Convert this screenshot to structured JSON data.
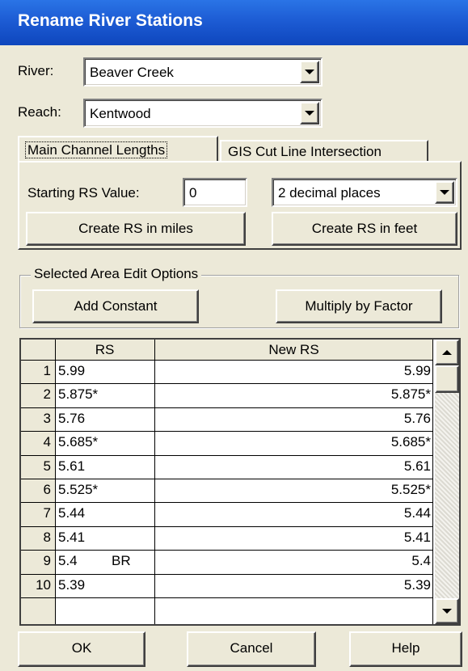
{
  "window": {
    "title": "Rename River Stations"
  },
  "river": {
    "label": "River:",
    "value": "Beaver Creek"
  },
  "reach": {
    "label": "Reach:",
    "value": "Kentwood"
  },
  "tabs": [
    {
      "label": "Main Channel Lengths",
      "active": true
    },
    {
      "label": "GIS Cut Line Intersection",
      "active": false
    }
  ],
  "main_channel": {
    "starting_rs_label": "Starting RS  Value:",
    "starting_rs_value": "0",
    "decimal_places": "2 decimal places",
    "create_miles_label": "Create RS in miles",
    "create_feet_label": "Create RS in feet"
  },
  "edit_options": {
    "group_title": "Selected Area Edit Options",
    "add_constant_label": "Add Constant",
    "multiply_factor_label": "Multiply by  Factor"
  },
  "table": {
    "columns": [
      "",
      "RS",
      "New RS"
    ],
    "rows": [
      {
        "num": "1",
        "rs": "5.99",
        "new_rs": "5.99"
      },
      {
        "num": "2",
        "rs": "5.875*",
        "new_rs": "5.875*"
      },
      {
        "num": "3",
        "rs": "5.76",
        "new_rs": "5.76"
      },
      {
        "num": "4",
        "rs": "5.685*",
        "new_rs": "5.685*"
      },
      {
        "num": "5",
        "rs": "5.61",
        "new_rs": "5.61"
      },
      {
        "num": "6",
        "rs": "5.525*",
        "new_rs": "5.525*"
      },
      {
        "num": "7",
        "rs": "5.44",
        "new_rs": "5.44"
      },
      {
        "num": "8",
        "rs": "5.41",
        "new_rs": "5.41"
      },
      {
        "num": "9",
        "rs": "5.4",
        "rs_tag": "BR",
        "new_rs": "5.4"
      },
      {
        "num": "10",
        "rs": "5.39",
        "new_rs": "5.39"
      }
    ]
  },
  "footer": {
    "ok_label": "OK",
    "cancel_label": "Cancel",
    "help_label": "Help"
  },
  "icons": {
    "dropdown": "chevron-down-icon",
    "scroll_up": "scroll-up-arrow-icon",
    "scroll_down": "scroll-down-arrow-icon"
  }
}
